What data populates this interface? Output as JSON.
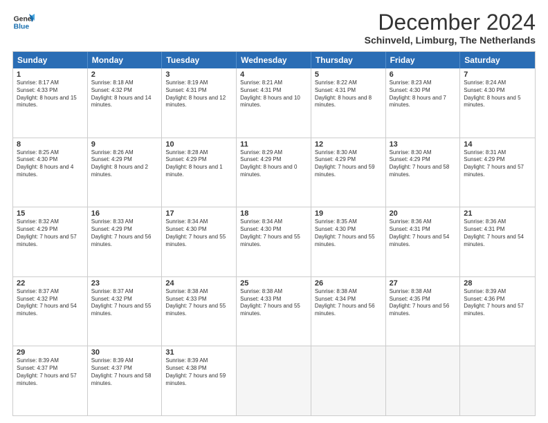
{
  "logo": {
    "line1": "General",
    "line2": "Blue"
  },
  "title": "December 2024",
  "location": "Schinveld, Limburg, The Netherlands",
  "days": [
    "Sunday",
    "Monday",
    "Tuesday",
    "Wednesday",
    "Thursday",
    "Friday",
    "Saturday"
  ],
  "weeks": [
    [
      {
        "day": "1",
        "rise": "8:17 AM",
        "set": "4:33 PM",
        "daylight": "8 hours and 15 minutes."
      },
      {
        "day": "2",
        "rise": "8:18 AM",
        "set": "4:32 PM",
        "daylight": "8 hours and 14 minutes."
      },
      {
        "day": "3",
        "rise": "8:19 AM",
        "set": "4:31 PM",
        "daylight": "8 hours and 12 minutes."
      },
      {
        "day": "4",
        "rise": "8:21 AM",
        "set": "4:31 PM",
        "daylight": "8 hours and 10 minutes."
      },
      {
        "day": "5",
        "rise": "8:22 AM",
        "set": "4:31 PM",
        "daylight": "8 hours and 8 minutes."
      },
      {
        "day": "6",
        "rise": "8:23 AM",
        "set": "4:30 PM",
        "daylight": "8 hours and 7 minutes."
      },
      {
        "day": "7",
        "rise": "8:24 AM",
        "set": "4:30 PM",
        "daylight": "8 hours and 5 minutes."
      }
    ],
    [
      {
        "day": "8",
        "rise": "8:25 AM",
        "set": "4:30 PM",
        "daylight": "8 hours and 4 minutes."
      },
      {
        "day": "9",
        "rise": "8:26 AM",
        "set": "4:29 PM",
        "daylight": "8 hours and 2 minutes."
      },
      {
        "day": "10",
        "rise": "8:28 AM",
        "set": "4:29 PM",
        "daylight": "8 hours and 1 minute."
      },
      {
        "day": "11",
        "rise": "8:29 AM",
        "set": "4:29 PM",
        "daylight": "8 hours and 0 minutes."
      },
      {
        "day": "12",
        "rise": "8:30 AM",
        "set": "4:29 PM",
        "daylight": "7 hours and 59 minutes."
      },
      {
        "day": "13",
        "rise": "8:30 AM",
        "set": "4:29 PM",
        "daylight": "7 hours and 58 minutes."
      },
      {
        "day": "14",
        "rise": "8:31 AM",
        "set": "4:29 PM",
        "daylight": "7 hours and 57 minutes."
      }
    ],
    [
      {
        "day": "15",
        "rise": "8:32 AM",
        "set": "4:29 PM",
        "daylight": "7 hours and 57 minutes."
      },
      {
        "day": "16",
        "rise": "8:33 AM",
        "set": "4:29 PM",
        "daylight": "7 hours and 56 minutes."
      },
      {
        "day": "17",
        "rise": "8:34 AM",
        "set": "4:30 PM",
        "daylight": "7 hours and 55 minutes."
      },
      {
        "day": "18",
        "rise": "8:34 AM",
        "set": "4:30 PM",
        "daylight": "7 hours and 55 minutes."
      },
      {
        "day": "19",
        "rise": "8:35 AM",
        "set": "4:30 PM",
        "daylight": "7 hours and 55 minutes."
      },
      {
        "day": "20",
        "rise": "8:36 AM",
        "set": "4:31 PM",
        "daylight": "7 hours and 54 minutes."
      },
      {
        "day": "21",
        "rise": "8:36 AM",
        "set": "4:31 PM",
        "daylight": "7 hours and 54 minutes."
      }
    ],
    [
      {
        "day": "22",
        "rise": "8:37 AM",
        "set": "4:32 PM",
        "daylight": "7 hours and 54 minutes."
      },
      {
        "day": "23",
        "rise": "8:37 AM",
        "set": "4:32 PM",
        "daylight": "7 hours and 55 minutes."
      },
      {
        "day": "24",
        "rise": "8:38 AM",
        "set": "4:33 PM",
        "daylight": "7 hours and 55 minutes."
      },
      {
        "day": "25",
        "rise": "8:38 AM",
        "set": "4:33 PM",
        "daylight": "7 hours and 55 minutes."
      },
      {
        "day": "26",
        "rise": "8:38 AM",
        "set": "4:34 PM",
        "daylight": "7 hours and 56 minutes."
      },
      {
        "day": "27",
        "rise": "8:38 AM",
        "set": "4:35 PM",
        "daylight": "7 hours and 56 minutes."
      },
      {
        "day": "28",
        "rise": "8:39 AM",
        "set": "4:36 PM",
        "daylight": "7 hours and 57 minutes."
      }
    ],
    [
      {
        "day": "29",
        "rise": "8:39 AM",
        "set": "4:37 PM",
        "daylight": "7 hours and 57 minutes."
      },
      {
        "day": "30",
        "rise": "8:39 AM",
        "set": "4:37 PM",
        "daylight": "7 hours and 58 minutes."
      },
      {
        "day": "31",
        "rise": "8:39 AM",
        "set": "4:38 PM",
        "daylight": "7 hours and 59 minutes."
      },
      null,
      null,
      null,
      null
    ]
  ]
}
